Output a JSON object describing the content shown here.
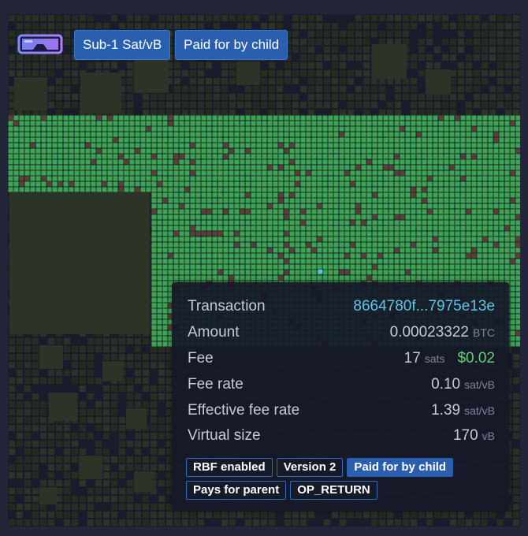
{
  "filters": {
    "goggles_icon": "goggles-icon",
    "tags": [
      "Sub-1 Sat/vB",
      "Paid for by child"
    ]
  },
  "tooltip": {
    "transaction": {
      "label": "Transaction",
      "value": "8664780f...7975e13e"
    },
    "amount": {
      "label": "Amount",
      "value": "0.00023322",
      "unit": "BTC"
    },
    "fee": {
      "label": "Fee",
      "value": "17",
      "unit": "sats",
      "fiat": "$0.02"
    },
    "fee_rate": {
      "label": "Fee rate",
      "value": "0.10",
      "unit": "sat/vB"
    },
    "effective_fee_rate": {
      "label": "Effective fee rate",
      "value": "1.39",
      "unit": "sat/vB"
    },
    "virtual_size": {
      "label": "Virtual size",
      "value": "170",
      "unit": "vB"
    },
    "badges": [
      {
        "label": "RBF enabled",
        "highlighted": false
      },
      {
        "label": "Version 2",
        "highlighted": false
      },
      {
        "label": "Paid for by child",
        "highlighted": true
      },
      {
        "label": "Pays for parent",
        "highlighted": false
      },
      {
        "label": "OP_RETURN",
        "highlighted": false
      }
    ]
  },
  "colors": {
    "highlight_green": "#3aa655",
    "dim_block": "#2c3327",
    "tx_blue": "#5dc6e8",
    "fiat_green": "#5fd27a",
    "accent_blue": "#2a5fb0"
  }
}
